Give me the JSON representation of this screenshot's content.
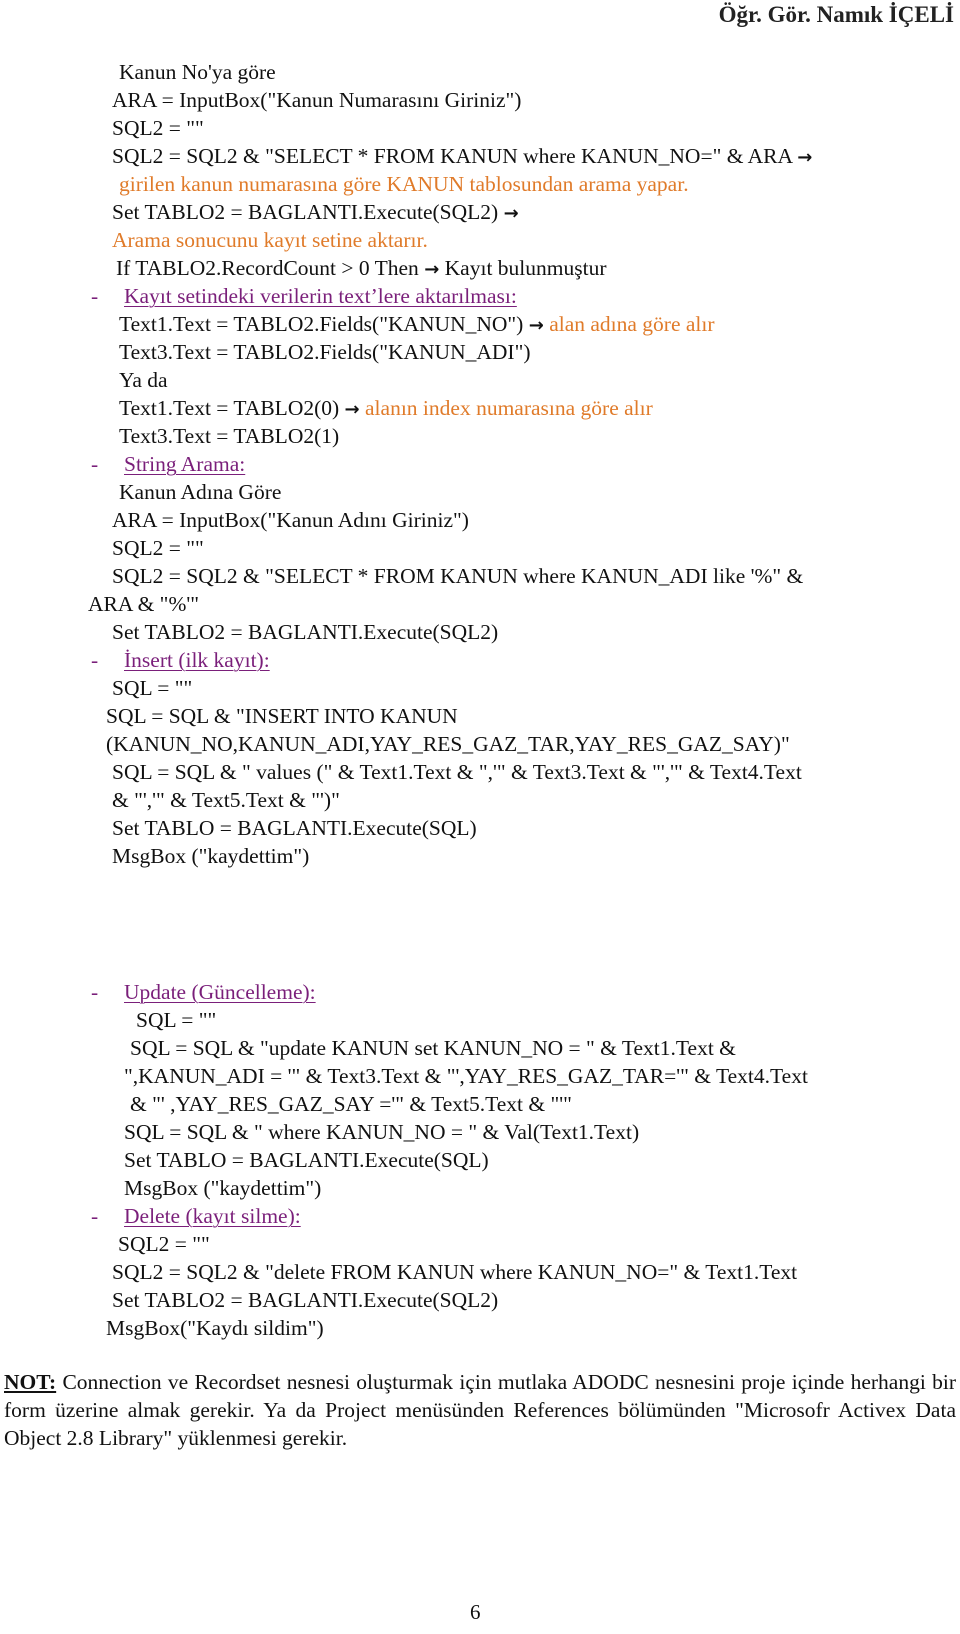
{
  "header": {
    "author": "Öğr. Gör. Namık İÇELİ"
  },
  "arrow_glyph": "→",
  "lines": {
    "l01": "Kanun No'ya göre",
    "l02": "ARA = InputBox(\"Kanun Numarasını Giriniz\")",
    "l03": "SQL2 = \"\"",
    "l04": "SQL2 = SQL2 & \"SELECT * FROM KANUN where KANUN_NO=\" & ARA",
    "l05": "girilen kanun numarasına göre KANUN tablosundan arama yapar.",
    "l06": "Set TABLO2 = BAGLANTI.Execute(SQL2)",
    "l07": "Arama sonucunu kayıt setine aktarır.",
    "l08a": "If TABLO2.RecordCount > 0 Then",
    "l08b": "Kayıt bulunmuştur",
    "h1": "Kayıt setindeki verilerin text’lere aktarılması:",
    "l09a": "Text1.Text = TABLO2.Fields(\"KANUN_NO\")",
    "l09b": "alan adına göre alır",
    "l10": "Text3.Text = TABLO2.Fields(\"KANUN_ADI\")",
    "l11": "Ya da",
    "l12a": "Text1.Text = TABLO2(0)",
    "l12b": "alanın index numarasına göre alır",
    "l13": "Text3.Text = TABLO2(1)",
    "h2": "String Arama:",
    "l14": "Kanun Adına Göre",
    "l15": "ARA = InputBox(\"Kanun Adını Giriniz\")",
    "l16": "SQL2 = \"\"",
    "l17": "SQL2 = SQL2 & \"SELECT * FROM KANUN where KANUN_ADI like '%\" &",
    "l18": "ARA & \"%'\"",
    "l19": "Set TABLO2 = BAGLANTI.Execute(SQL2)",
    "h3": "İnsert (ilk kayıt):",
    "l20": "SQL = \"\"",
    "l21": "SQL = SQL & \"INSERT INTO KANUN",
    "l22": "(KANUN_NO,KANUN_ADI,YAY_RES_GAZ_TAR,YAY_RES_GAZ_SAY)\"",
    "l23": "SQL = SQL & \" values (\" & Text1.Text & \",'\" & Text3.Text & \"','\" & Text4.Text",
    "l24": "& \"','\" & Text5.Text & \"')\"",
    "l25": "Set TABLO = BAGLANTI.Execute(SQL)",
    "l26": "MsgBox (\"kaydettim\")",
    "h4": "Update (Güncelleme):",
    "l27": "SQL = \"\"",
    "l28": "SQL = SQL & \"update  KANUN  set KANUN_NO = \" & Text1.Text &",
    "l29": "\",KANUN_ADI = '\" & Text3.Text & \"',YAY_RES_GAZ_TAR='\" & Text4.Text",
    "l30": "& \"' ,YAY_RES_GAZ_SAY ='\" & Text5.Text & \"'\"",
    "l31": "SQL = SQL & \" where KANUN_NO = \" & Val(Text1.Text)",
    "l32": "Set TABLO = BAGLANTI.Execute(SQL)",
    "l33": "MsgBox (\"kaydettim\")",
    "h5": "Delete (kayıt silme):",
    "l34": "SQL2 = \"\"",
    "l35": "SQL2 = SQL2 & \"delete FROM KANUN where KANUN_NO=\" & Text1.Text",
    "l36": "Set TABLO2 = BAGLANTI.Execute(SQL2)",
    "l37": "MsgBox(\"Kaydı sildim\")"
  },
  "bullet": "-",
  "note": {
    "label": "NOT:",
    "text": " Connection ve Recordset nesnesi oluşturmak için mutlaka ADODC nesnesini proje içinde herhangi bir form üzerine almak gerekir. Ya da Project menüsünden References bölümünden \"Microsofr Activex Data Object 2.8 Library\" yüklenmesi gerekir."
  },
  "page_number": "6"
}
